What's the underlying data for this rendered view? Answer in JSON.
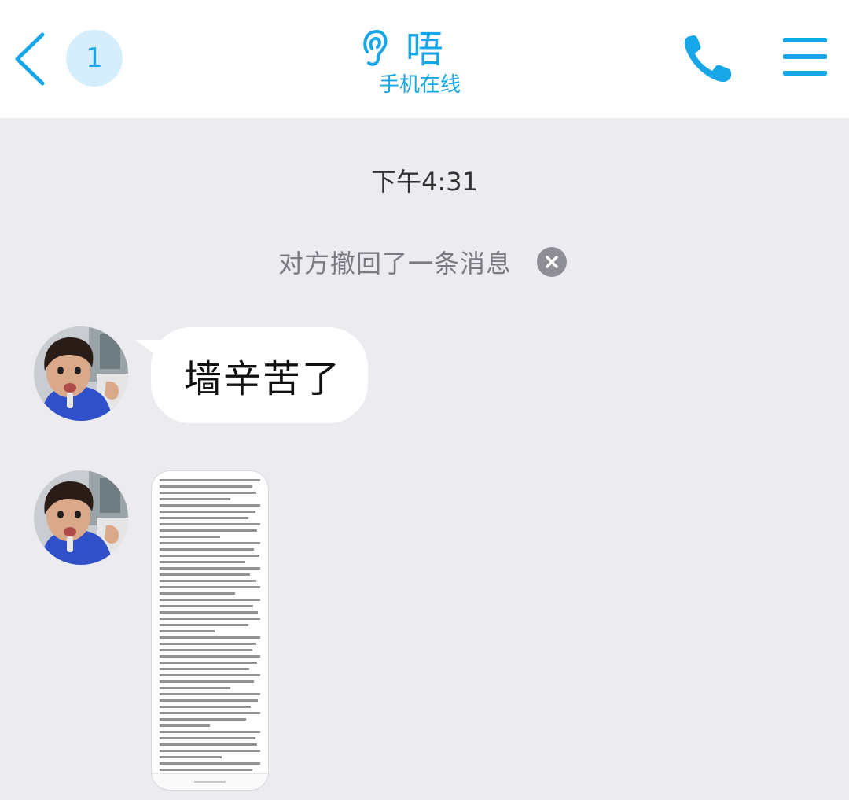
{
  "header": {
    "back_icon": "chevron-left-icon",
    "unread_count": "1",
    "contact_name": "唔",
    "status_icon": "ear-icon",
    "status_text": "手机在线",
    "call_icon": "phone-icon",
    "menu_icon": "hamburger-menu-icon",
    "accent_color": "#17a6e8"
  },
  "chat": {
    "timestamp": "下午4:31",
    "recall_notice": "对方撤回了一条消息",
    "recall_close_icon": "close-circle-icon",
    "messages": [
      {
        "type": "text",
        "sender": "contact",
        "text": "墙辛苦了"
      },
      {
        "type": "image",
        "sender": "contact",
        "description_icon": "document-screenshot-thumbnail"
      }
    ]
  },
  "colors": {
    "background": "#ebebf0",
    "bubble": "#ffffff",
    "recall_text": "#7a7a82"
  }
}
